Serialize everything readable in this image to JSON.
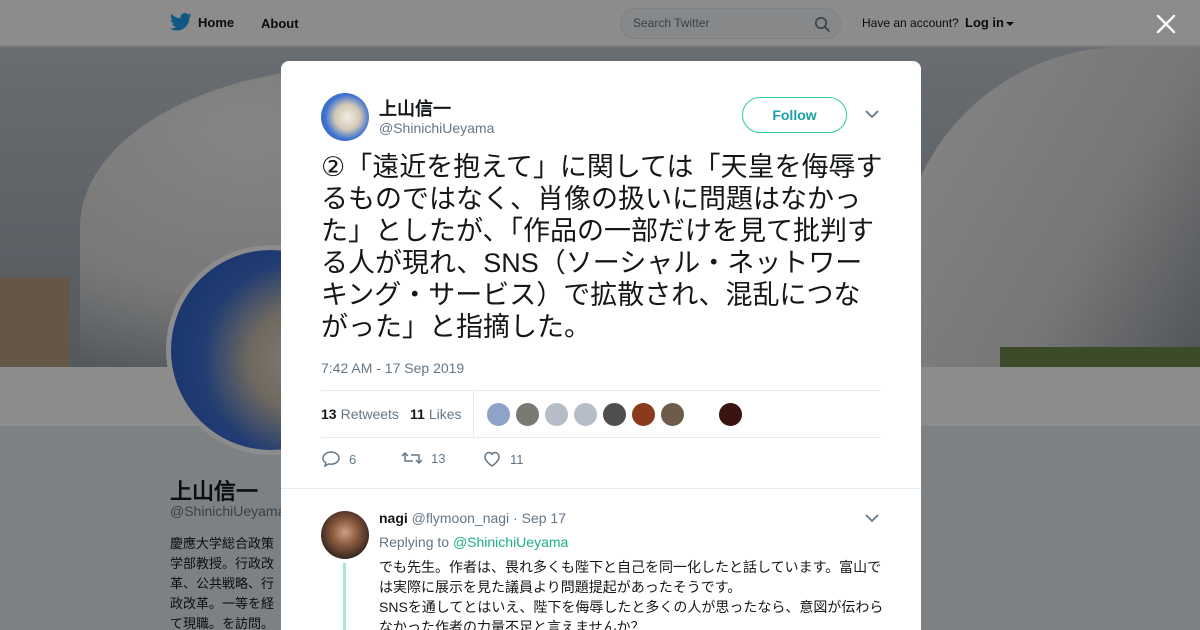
{
  "nav": {
    "home_label": "Home",
    "about_label": "About",
    "search_placeholder": "Search Twitter",
    "account_prompt": "Have an account?",
    "login_label": "Log in"
  },
  "profile": {
    "name": "上山信一",
    "handle": "@ShinichiUeyama",
    "bio": "慶應大学総合政策学部教授。行政改革、公共戦略、行政改革。一等を経て現職。を訪問。大阪・豊別顧問、東京都顧問"
  },
  "tweet": {
    "user_name": "上山信一",
    "user_handle": "@ShinichiUeyama",
    "follow_label": "Follow",
    "text": "②「遠近を抱えて」に関しては「天皇を侮辱するものではなく、肖像の扱いに問題はなかった」としたが、「作品の一部だけを見て批判する人が現れ、SNS（ソーシャル・ネットワーキング・サービス）で拡散され、混乱につながった」と指摘した。",
    "timestamp": "7:42 AM - 17 Sep 2019",
    "retweets_count": "13",
    "retweets_label": "Retweets",
    "likes_count": "11",
    "likes_label": "Likes",
    "replies_action_count": "6",
    "retweets_action_count": "13",
    "likes_action_count": "11"
  },
  "reply": {
    "name": "nagi",
    "handle": "@flymoon_nagi",
    "date": "· Sep 17",
    "replying_to_label": "Replying to",
    "replying_to_handle": "@ShinichiUeyama",
    "text": "でも先生。作者は、畏れ多くも陛下と自己を同一化したと話しています。富山では実際に展示を見た議員より問題提起があったそうです。\nSNSを通してとはいえ、陛下を侮辱したと多くの人が思ったなら、意図が伝わらなかった作者の力量不足と言えませんか？"
  },
  "colors": {
    "accent_green": "#2ecc9a",
    "text_primary": "#14171a",
    "text_secondary": "#657786",
    "twitter_blue": "#1da1f2"
  },
  "likers": [
    "#8fa3c8",
    "#7a7a72",
    "#b5bec8",
    "#b5bec8",
    "#4e4e4e",
    "#8a3b1e",
    "#6d5c4a",
    "#3a1210"
  ]
}
